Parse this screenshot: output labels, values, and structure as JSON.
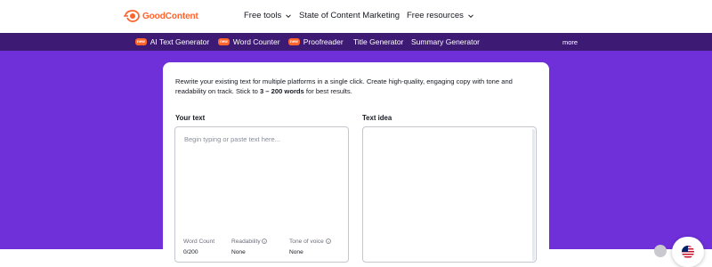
{
  "header": {
    "brand": "GoodContent",
    "nav": [
      {
        "label": "Free tools"
      },
      {
        "label": "State of Content Marketing"
      },
      {
        "label": "Free resources"
      }
    ]
  },
  "subnav": {
    "badge_label": "new",
    "items": [
      {
        "label": "AI Text Generator",
        "new": true
      },
      {
        "label": "Word Counter",
        "new": true
      },
      {
        "label": "Proofreader",
        "new": true
      },
      {
        "label": "Title Generator",
        "new": false
      },
      {
        "label": "Summary Generator",
        "new": false
      }
    ],
    "more_label": "more"
  },
  "tool": {
    "intro_line1": "Rewrite your existing text for multiple platforms in a single click. Create high-quality, engaging copy with tone and",
    "intro_line2_pre": "readability on track. Stick to ",
    "intro_line2_bold": "3 – 200 words",
    "intro_line2_post": " for best results.",
    "your_text_label": "Your text",
    "text_idea_label": "Text idea",
    "input_placeholder": "Begin typing or paste text here...",
    "stats": [
      {
        "label": "Word Count",
        "value": "0/200"
      },
      {
        "label": "Readability",
        "value": "None"
      },
      {
        "label": "Tone of voice",
        "value": "None"
      }
    ]
  },
  "colors": {
    "brand_orange": "#ff642d",
    "subnav_bg": "#3d1a73",
    "hero_purple": "#6f2fd9"
  },
  "icons": {
    "chevron": "chevron-down-icon",
    "logo": "semrush-fire-icon",
    "flag": "us-flag-icon",
    "info": "info-icon"
  }
}
